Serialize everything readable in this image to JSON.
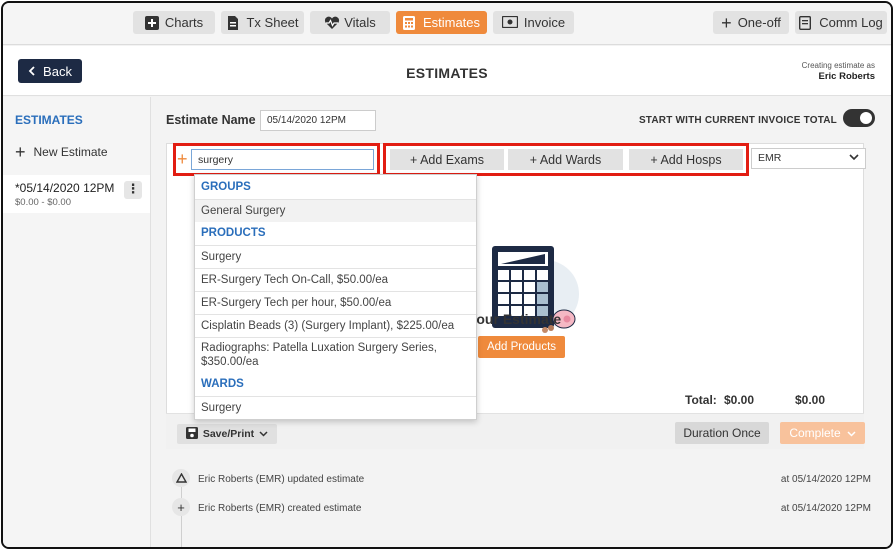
{
  "nav": {
    "tabs": [
      {
        "label": "Charts",
        "icon": "plus-square-icon"
      },
      {
        "label": "Tx Sheet",
        "icon": "document-icon"
      },
      {
        "label": "Vitals",
        "icon": "heart-pulse-icon"
      },
      {
        "label": "Estimates",
        "icon": "calculator-icon",
        "active": true
      },
      {
        "label": "Invoice",
        "icon": "money-icon"
      }
    ],
    "one_off": "One-off",
    "comm_log": "Comm Log"
  },
  "header": {
    "back_label": "Back",
    "title": "ESTIMATES",
    "creating_as_label": "Creating estimate as",
    "creating_as_user": "Eric Roberts"
  },
  "sidebar": {
    "title": "ESTIMATES",
    "new_estimate": "New Estimate",
    "items": [
      {
        "name": "*05/14/2020 12PM",
        "range": "$0.00 - $0.00"
      }
    ]
  },
  "main": {
    "estimate_name_label": "Estimate Name",
    "estimate_name_value": "05/14/2020 12PM",
    "start_total_label": "START WITH CURRENT INVOICE TOTAL",
    "search_value": "surgery",
    "add_exams": "+ Add Exams",
    "add_wards": "+ Add Wards",
    "add_hosps": "+ Add Hosps",
    "provider_select": "EMR",
    "create_text": "te Your Estimate",
    "add_products": "Add Products",
    "total_label": "Total:",
    "total_value_1": "$0.00",
    "total_value_2": "$0.00",
    "save_print": "Save/Print",
    "duration_once": "Duration Once",
    "complete": "Complete"
  },
  "dropdown": {
    "groups_header": "GROUPS",
    "groups": [
      "General Surgery"
    ],
    "products_header": "PRODUCTS",
    "products": [
      "Surgery",
      "ER-Surgery Tech On-Call, $50.00/ea",
      "ER-Surgery Tech per hour, $50.00/ea",
      "Cisplatin Beads (3) (Surgery Implant), $225.00/ea",
      "Radiographs: Patella Luxation Surgery Series, $350.00/ea"
    ],
    "wards_header": "WARDS",
    "wards": [
      "Surgery"
    ]
  },
  "activity": [
    {
      "icon": "triangle-icon",
      "text": "Eric Roberts (EMR) updated estimate",
      "time": "at 05/14/2020 12PM"
    },
    {
      "icon": "plus-icon",
      "text": "Eric Roberts (EMR) created estimate",
      "time": "at 05/14/2020 12PM"
    }
  ],
  "colors": {
    "accent": "#ef8a3c",
    "navy": "#1d2a44",
    "link_blue": "#2a6ebb",
    "highlight_red": "#e21d12"
  }
}
